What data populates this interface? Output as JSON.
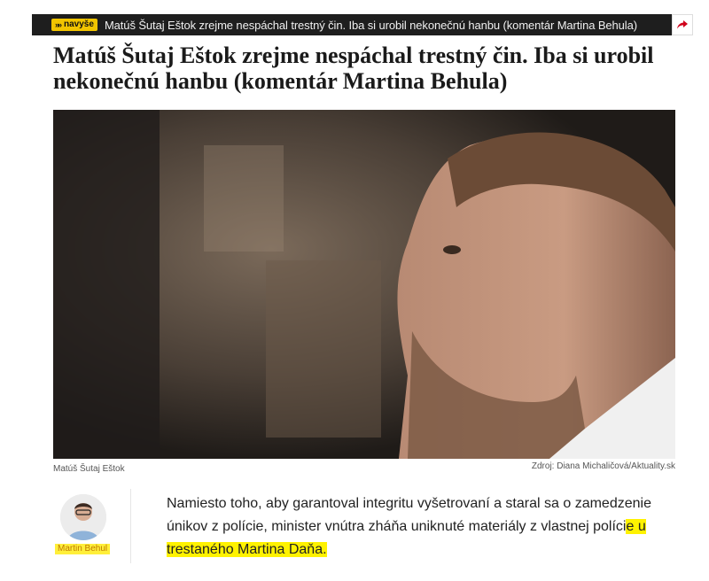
{
  "topbar": {
    "badge_arrows": "»»",
    "badge_label": "navyše",
    "title": "Matúš Šutaj Eštok zrejme nespáchal trestný čin. Iba si urobil nekonečnú hanbu (komentár Martina Behula)",
    "share_icon": "share-arrow-icon"
  },
  "article": {
    "headline": "Matúš Šutaj Eštok zrejme nespáchal trestný čin. Iba si urobil nekonečnú hanbu (komentár Martina Behula)",
    "photo_caption": "Matúš Šutaj Eštok",
    "photo_source": "Zdroj: Diana Michaličová/Aktuality.sk",
    "author_name": "Martin Behul",
    "body_part1": "Namiesto toho, aby garantoval integritu vyšetrovaní a staral sa o zamedzenie únikov z polície, minister vnútra zháňa uniknuté materiály z vlastnej políci",
    "body_highlight": "e u trestaného Martina Daňa."
  },
  "colors": {
    "topbar_bg": "#1e1e1e",
    "badge_bg": "#f2c500",
    "highlight": "#fff200",
    "author_link": "#c07a00"
  }
}
